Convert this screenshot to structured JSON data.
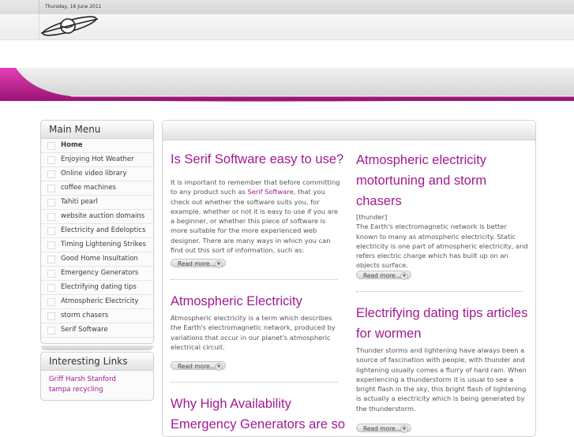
{
  "header": {
    "date": "Thursday, 16 June 2011"
  },
  "main_menu": {
    "title": "Main Menu",
    "items": [
      "Home",
      "Enjoying Hot Weather",
      "Online video library",
      "coffee machines",
      "Tahiti pearl",
      "website auction domains",
      "Electricity and Edeloptics",
      "Timing Lightening Strikes",
      "Good Home Insultation",
      "Emergency Generators",
      "Electrifying dating tips",
      "Atmospheric Electricity",
      "storm chasers",
      "Serif Software"
    ]
  },
  "interesting_links": {
    "title": "Interesting Links",
    "links": [
      "Griff Harsh Stanford",
      "tampa recycling"
    ]
  },
  "articles": {
    "a1": {
      "title": "Is Serif Software easy to use?",
      "text_before": "It is important to remember that before committing to any product such as ",
      "link": "Serif Software",
      "text_after": ", that you check out whether the software suits you, for example, whether or not it is easy to use if you are a beginner, or whether this piece of software is more suitable for the more experienced web designer. There are many ways in which you can find out this sort of information, such as:",
      "readmore": "Read more..."
    },
    "a2": {
      "title": "Atmospheric Electricity",
      "text": "Atmospheric electricity is a term which describes the Earth's electromagnetic network, produced by variations that occur in our planet's atmospheric electrical circuit.",
      "readmore": "Read more..."
    },
    "a3": {
      "title_line1": "Why High Availability",
      "title_line2": "Emergency Generators are so"
    },
    "b1": {
      "title_line1": "Atmospheric electricity",
      "title_line2": "motortuning and storm",
      "title_line3": "chasers",
      "tag": "[thunder]",
      "text": "The Earth's electromagnetic network is better known to many as atmospheric electricity. Static electricity is one part of atmospheric electricity, and refers electric charge which has built up on an objects surface.",
      "readmore": "Read more..."
    },
    "b2": {
      "title_line1": "Electrifying dating tips articles",
      "title_line2": "for wormen",
      "text": "Thunder storms and lightening have always been a source of fascination with people, with thunder and lightening usually comes a flurry of hard rain. When experiencing a thunderstorm it is usual to see a bright flash in the sky, this bright flash of lightening is actually a electricity which is being generated by the thunderstorm.",
      "readmore": "Read more..."
    }
  },
  "colors": {
    "accent": "#a21a92",
    "swoosh": "#b0187f"
  }
}
